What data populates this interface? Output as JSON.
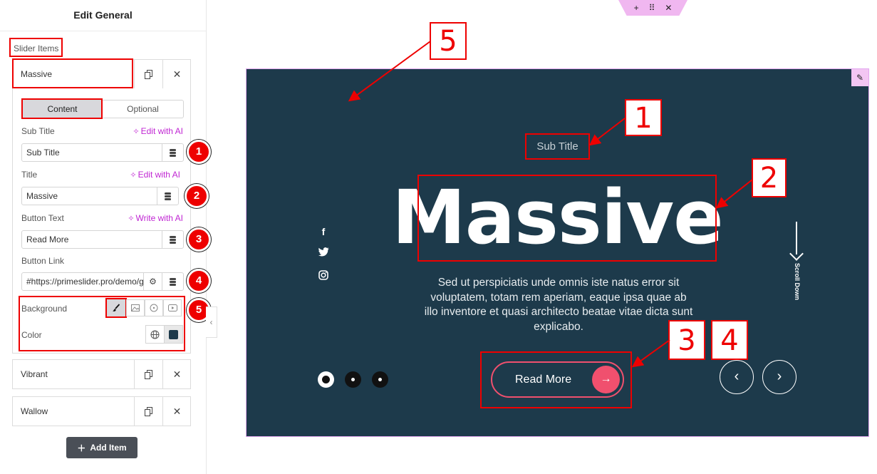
{
  "panel": {
    "title": "Edit General",
    "section_label": "Slider Items",
    "items": [
      {
        "name": "Massive"
      },
      {
        "name": "Vibrant"
      },
      {
        "name": "Wallow"
      }
    ],
    "tabs": [
      {
        "label": "Content",
        "active": true
      },
      {
        "label": "Optional",
        "active": false
      }
    ],
    "fields": {
      "sub_title": {
        "label": "Sub Title",
        "ai_label": "Edit with AI",
        "value": "Sub Title"
      },
      "title": {
        "label": "Title",
        "ai_label": "Edit with AI",
        "value": "Massive"
      },
      "button_text": {
        "label": "Button Text",
        "ai_label": "Write with AI",
        "value": "Read More"
      },
      "button_link": {
        "label": "Button Link",
        "value": "#https://primeslider.pro/demo/g"
      },
      "background": {
        "label": "Background",
        "options": [
          "classic-brush-icon",
          "image-icon",
          "gradient-icon",
          "video-icon"
        ],
        "selected": "classic-brush-icon"
      },
      "color": {
        "label": "Color",
        "swatch": "#1d3a4b"
      }
    },
    "badges": [
      "1",
      "2",
      "3",
      "4",
      "5"
    ],
    "add_item_label": "Add Item"
  },
  "canvas": {
    "toolbar": {
      "icons": [
        "plus-icon",
        "drag-handle-icon",
        "close-icon"
      ]
    },
    "slide": {
      "background": "#1d3a4b",
      "accent": "#f0506e",
      "sub_title": "Sub Title",
      "title": "Massive",
      "description": "Sed ut perspiciatis unde omnis iste natus error sit voluptatem, totam rem aperiam, eaque ipsa quae ab illo inventore et quasi architecto beatae vitae dicta sunt explicabo.",
      "button_text": "Read More",
      "scroll_text": "Scroll Down",
      "social": [
        "facebook-icon",
        "twitter-icon",
        "instagram-icon"
      ],
      "pagination": {
        "count": 3,
        "active": 1
      }
    },
    "annotations": [
      "1",
      "2",
      "3",
      "4",
      "5"
    ]
  }
}
